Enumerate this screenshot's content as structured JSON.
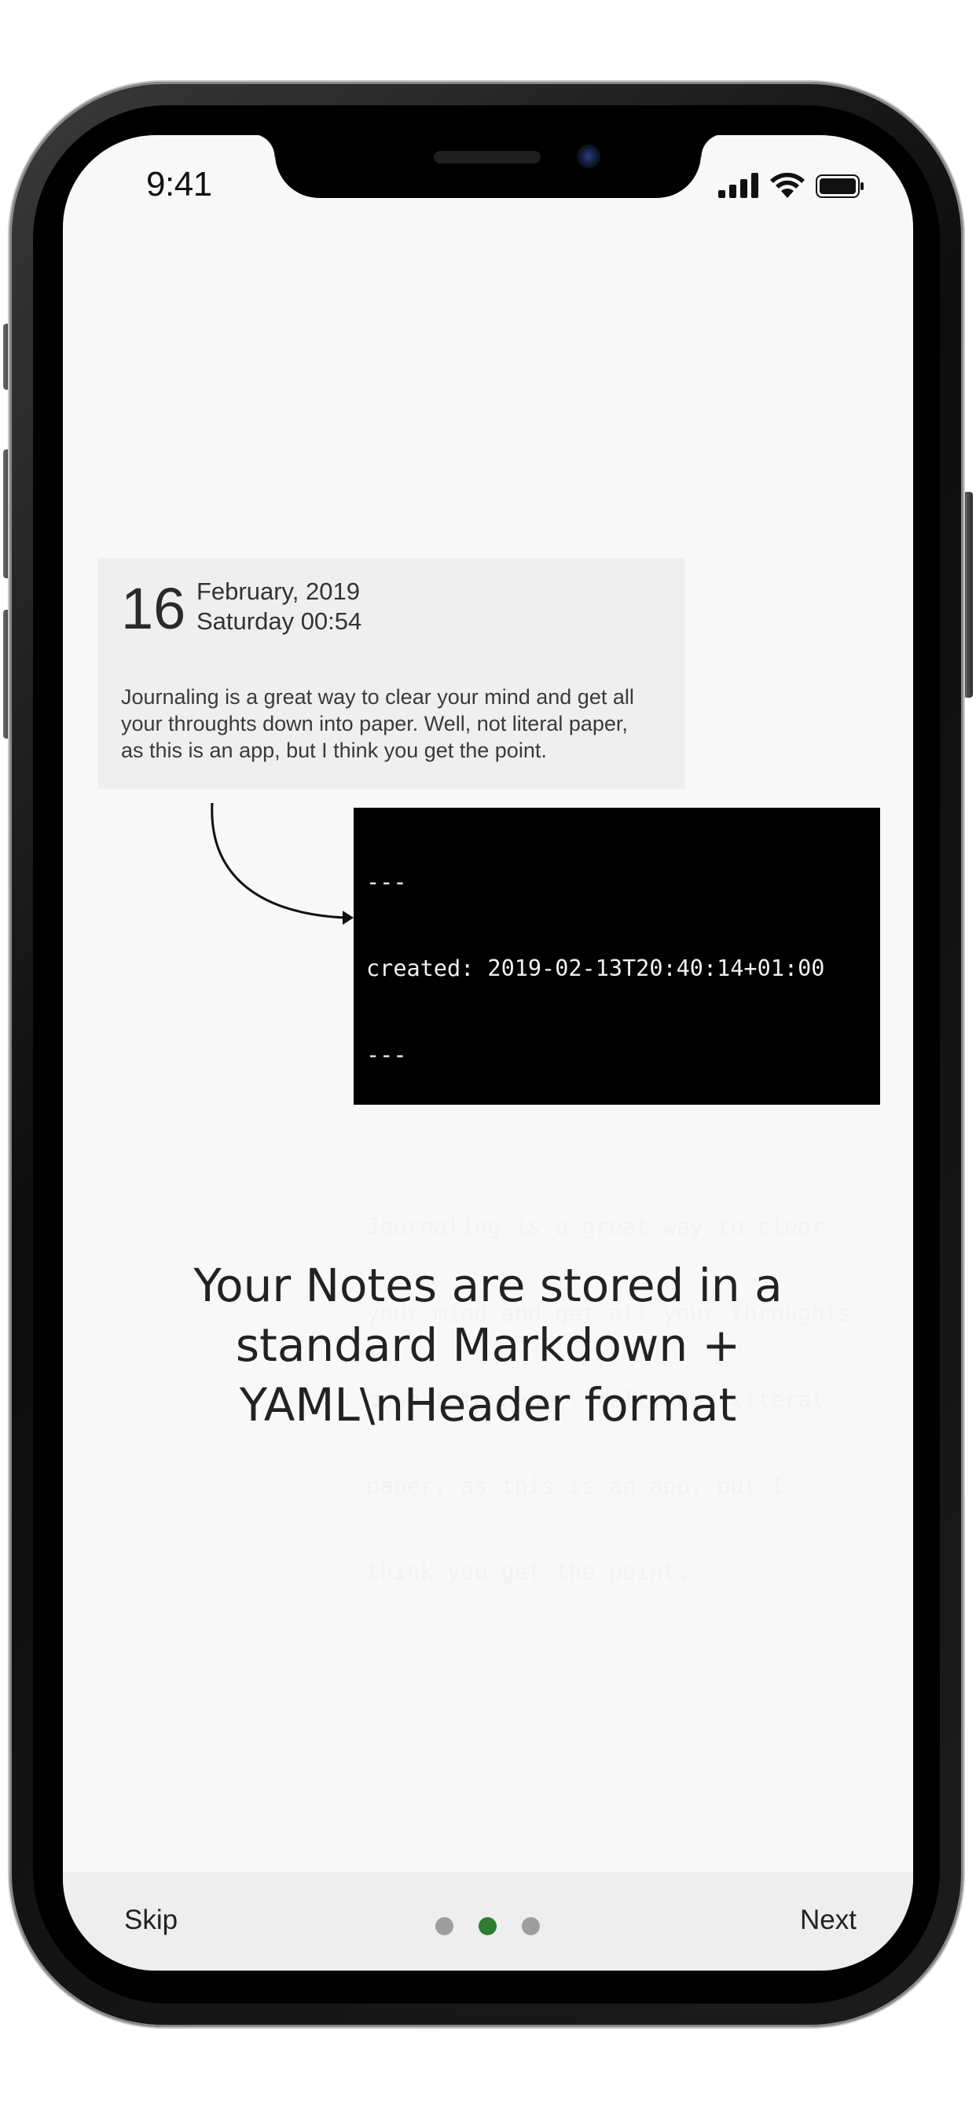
{
  "status_bar": {
    "time": "9:41"
  },
  "journal_card": {
    "day": "16",
    "month_year": "February, 2019",
    "weekday_time": "Saturday 00:54",
    "body": "Journaling is a great way to clear your mind and get all your throughts down into paper. Well, not literal paper, as this is an app, but I think you get the point."
  },
  "terminal": {
    "lines": [
      "---",
      "created: 2019-02-13T20:40:14+01:00",
      "---",
      "",
      "Journaling is a great way to clear",
      "your mind and get all your throughts",
      "down into paper. Well, not literal",
      "paper, as this is an app, but I",
      "think you get the point."
    ]
  },
  "headline": "Your Notes are stored in a standard Markdown + YAML\\nHeader format",
  "bottom_nav": {
    "skip_label": "Skip",
    "next_label": "Next",
    "page_count": 3,
    "active_page": 2,
    "active_color": "#2e7d32",
    "inactive_color": "#9e9e9e"
  },
  "icons": [
    "signal-icon",
    "wifi-icon",
    "battery-icon",
    "arrow-icon"
  ]
}
